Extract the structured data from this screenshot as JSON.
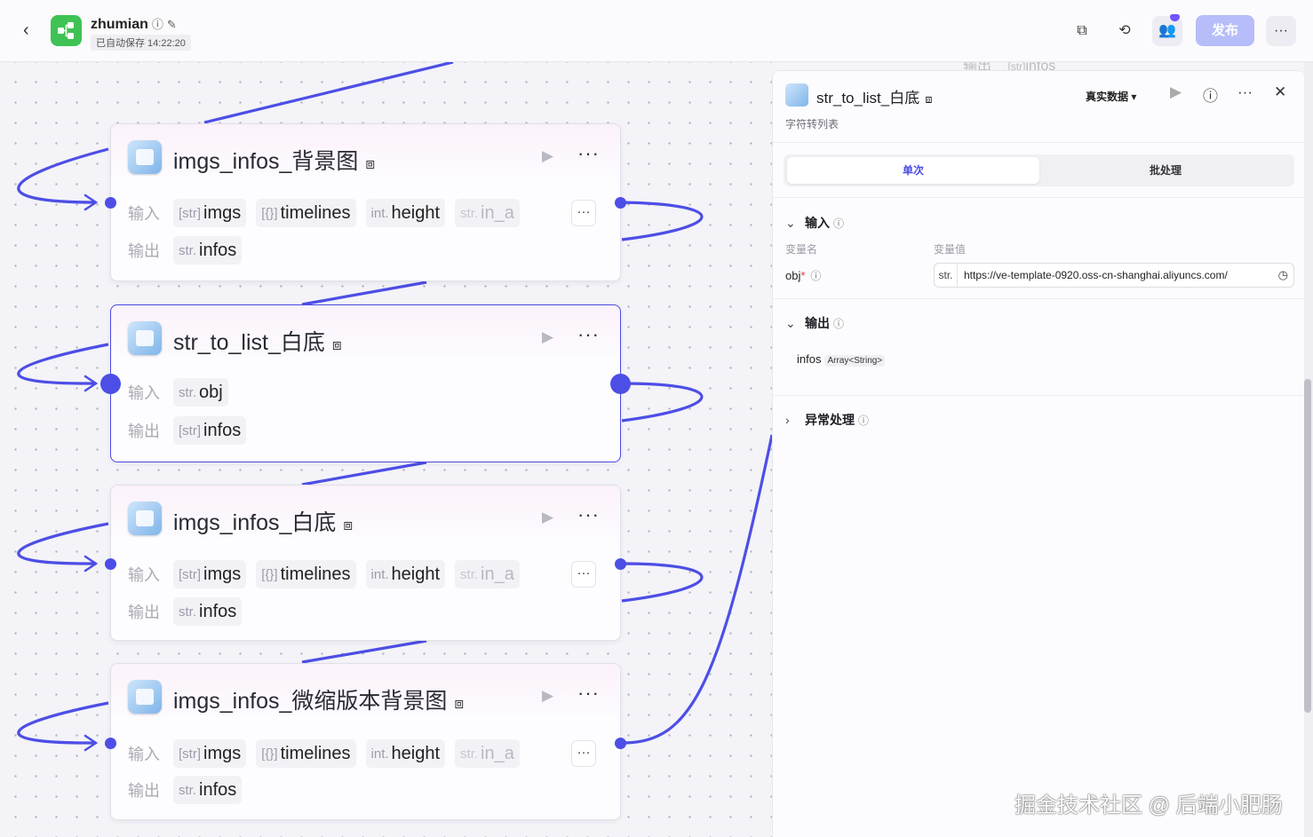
{
  "topbar": {
    "app_name": "zhumian",
    "autosave": "已自动保存 14:22:20",
    "publish_label": "发布",
    "more_label": "···"
  },
  "canvas": {
    "nodes": [
      {
        "title": "imgs_infos_背景图",
        "input_label": "输入",
        "output_label": "输出",
        "inputs": [
          {
            "type": "[str]",
            "name": "imgs"
          },
          {
            "type": "[{}]",
            "name": "timelines"
          },
          {
            "type": "int.",
            "name": "height"
          },
          {
            "type": "str.",
            "name": "in_a"
          }
        ],
        "outputs": [
          {
            "type": "str.",
            "name": "infos"
          }
        ]
      },
      {
        "title": "str_to_list_白底",
        "input_label": "输入",
        "output_label": "输出",
        "inputs": [
          {
            "type": "str.",
            "name": "obj"
          }
        ],
        "outputs": [
          {
            "type": "[str]",
            "name": "infos"
          }
        ]
      },
      {
        "title": "imgs_infos_白底",
        "input_label": "输入",
        "output_label": "输出",
        "inputs": [
          {
            "type": "[str]",
            "name": "imgs"
          },
          {
            "type": "[{}]",
            "name": "timelines"
          },
          {
            "type": "int.",
            "name": "height"
          },
          {
            "type": "str.",
            "name": "in_a"
          }
        ],
        "outputs": [
          {
            "type": "str.",
            "name": "infos"
          }
        ]
      },
      {
        "title": "imgs_infos_微缩版本背景图",
        "input_label": "输入",
        "output_label": "输出",
        "inputs": [
          {
            "type": "[str]",
            "name": "imgs"
          },
          {
            "type": "[{}]",
            "name": "timelines"
          },
          {
            "type": "int.",
            "name": "height"
          },
          {
            "type": "str.",
            "name": "in_a"
          }
        ],
        "outputs": [
          {
            "type": "str.",
            "name": "infos"
          }
        ]
      }
    ],
    "ghost_text": {
      "label": "输出",
      "type": "[str]",
      "name": "infos"
    }
  },
  "panel": {
    "title": "str_to_list_白底",
    "subtitle": "字符转列表",
    "mode_label": "真实数据",
    "tabs": [
      "单次",
      "批处理"
    ],
    "input_section": "输入",
    "col_name": "变量名",
    "col_value": "变量值",
    "param_name": "obj",
    "param_required": "*",
    "param_type": "str.",
    "param_value": "https://ve-template-0920.oss-cn-shanghai.aliyuncs.com/",
    "output_section": "输出",
    "output_name": "infos",
    "output_type": "Array<String>",
    "error_section": "异常处理"
  },
  "watermark": "掘金技术社区 @ 后端小肥肠",
  "colors": {
    "accent": "#4d4ee5",
    "publish_bg": "#b6bdf9",
    "logo": "#3ec254"
  }
}
